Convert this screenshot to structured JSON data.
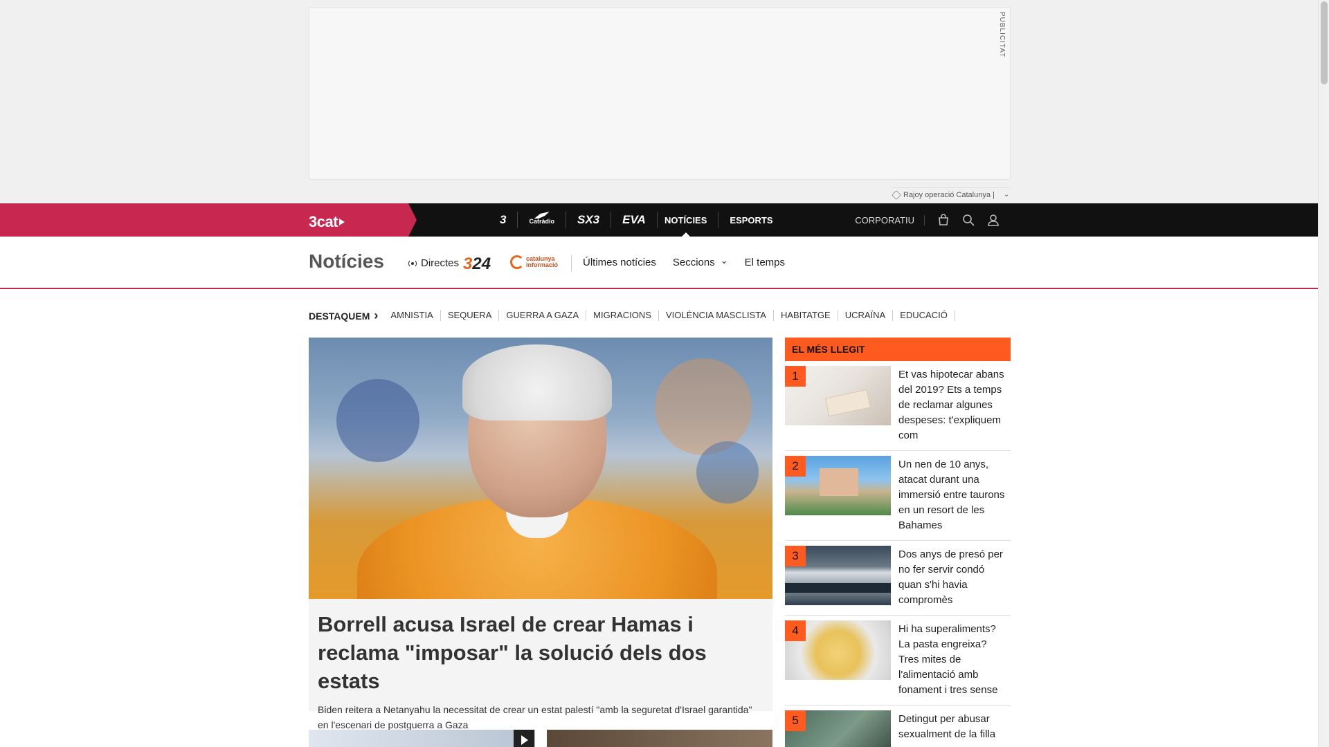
{
  "ad": {
    "label": "PUBLICITAT",
    "note": "Rajoy operació Catalunya |"
  },
  "topnav": {
    "logo": "3cat",
    "channels": [
      "3",
      "Catràdio",
      "SX3",
      "EVA"
    ],
    "links": [
      {
        "label": "NOTÍCIES",
        "active": true
      },
      {
        "label": "ESPORTS",
        "active": false
      }
    ],
    "corporate": "CORPORATIU",
    "icons": [
      "shop-icon",
      "search-icon",
      "user-icon"
    ]
  },
  "section": {
    "title": "Notícies",
    "directes": "Directes",
    "logo_324": {
      "prefix": "3",
      "suffix": "24"
    },
    "logo_ci": {
      "line1": "catalunya",
      "line2": "informació"
    },
    "links": [
      "Últimes notícies",
      "Seccions",
      "El temps"
    ]
  },
  "destaquem": {
    "label": "DESTAQUEM",
    "topics": [
      "AMNISTIA",
      "SEQUERA",
      "GUERRA A GAZA",
      "MIGRACIONS",
      "VIOLÈNCIA MASCLISTA",
      "HABITATGE",
      "UCRAÏNA",
      "EDUCACIÓ"
    ]
  },
  "lead": {
    "headline": "Borrell acusa Israel de crear Hamas i reclama \"imposar\" la solució dels dos estats",
    "summary": "Biden reitera a Netanyahu la necessitat de crear un estat palestí \"amb la seguretat d'Israel garantida\" en l'escenari de postguerra a Gaza"
  },
  "mostread": {
    "title": "EL MÉS LLEGIT",
    "items": [
      {
        "num": "1",
        "text": "Et vas hipotecar abans del 2019? Ets a temps de reclamar algunes despeses: t'expliquem com"
      },
      {
        "num": "2",
        "text": "Un nen de 10 anys, atacat durant una immersió entre taurons en un resort de les Bahames"
      },
      {
        "num": "3",
        "text": "Dos anys de presó per no fer servir condó quan s'hi havia compromès"
      },
      {
        "num": "4",
        "text": "Hi ha superaliments? La pasta engreixa? Tres mites de l'alimentació amb fonament i tres sense"
      },
      {
        "num": "5",
        "text": "Detingut per abusar sexualment de la filla"
      }
    ]
  },
  "colors": {
    "brand_red": "#c8284f",
    "accent_orange": "#ff5a1f",
    "nav_black": "#111111"
  }
}
